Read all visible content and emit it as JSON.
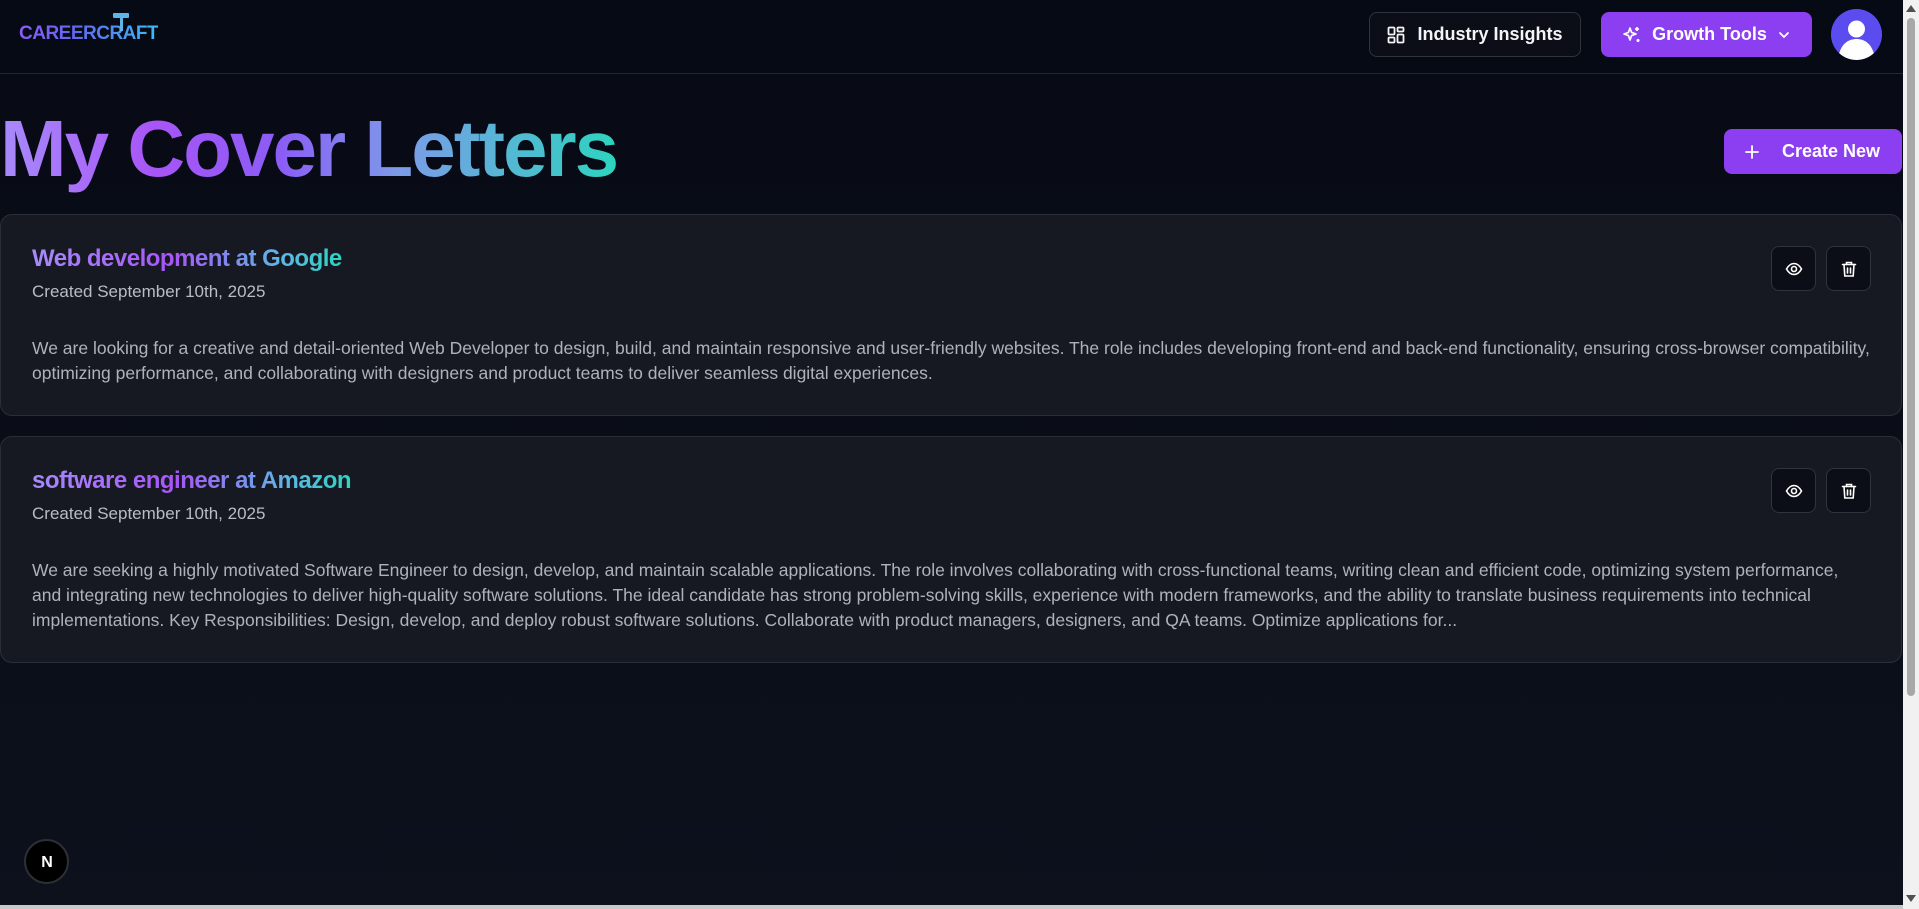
{
  "nav": {
    "logo": "CAREERCRAFT",
    "insights_label": "Industry Insights",
    "growth_label": "Growth Tools"
  },
  "page": {
    "title": "My Cover Letters",
    "create_label": "Create New"
  },
  "letters": [
    {
      "title": "Web development at Google",
      "created": "Created September 10th, 2025",
      "description": "We are looking for a creative and detail-oriented Web Developer to design, build, and maintain responsive and user-friendly websites. The role includes developing front-end and back-end functionality, ensuring cross-browser compatibility, optimizing performance, and collaborating with designers and product teams to deliver seamless digital experiences."
    },
    {
      "title": "software engineer at Amazon",
      "created": "Created September 10th, 2025",
      "description": "We are seeking a highly motivated Software Engineer to design, develop, and maintain scalable applications. The role involves collaborating with cross-functional teams, writing clean and efficient code, optimizing system performance, and integrating new technologies to deliver high-quality software solutions. The ideal candidate has strong problem-solving skills, experience with modern frameworks, and the ability to translate business requirements into technical implementations. Key Responsibilities: Design, develop, and deploy robust software solutions. Collaborate with product managers, designers, and QA teams. Optimize applications for..."
    }
  ],
  "badge": {
    "letter": "N"
  },
  "icons": {
    "insights": "layout-grid-icon",
    "growth": "sparkles-icon",
    "growth_caret": "chevron-down-icon",
    "avatar": "user-avatar-icon",
    "create": "plus-icon",
    "view": "eye-icon",
    "delete": "trash-icon"
  },
  "colors": {
    "accent": "#8b3ff0",
    "background": "#070a14",
    "card": "#171922"
  }
}
